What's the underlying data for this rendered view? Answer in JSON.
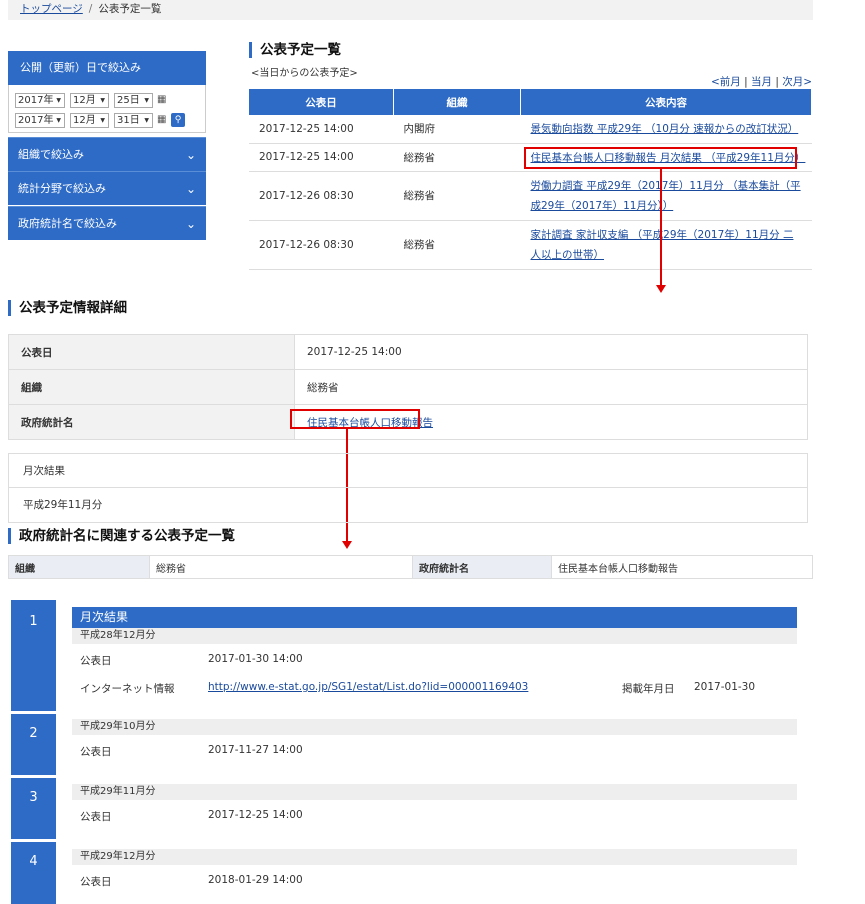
{
  "breadcrumb": {
    "home": "トップページ",
    "sep": "/",
    "current": "公表予定一覧"
  },
  "sidebar": {
    "date_filter_title": "公開（更新）日で絞込み",
    "from": {
      "year": "2017年",
      "month": "12月",
      "day": "25日"
    },
    "to": {
      "year": "2017年",
      "month": "12月",
      "day": "31日"
    },
    "items": [
      {
        "label": "組織で絞込み"
      },
      {
        "label": "統計分野で絞込み"
      },
      {
        "label": "政府統計名で絞込み"
      }
    ]
  },
  "schedule": {
    "title": "公表予定一覧",
    "subtitle": "<当日からの公表予定>",
    "nav": {
      "prev": "<前月",
      "current": "当月",
      "next": "次月>",
      "sep": "|"
    },
    "headers": {
      "date": "公表日",
      "org": "組織",
      "content": "公表内容"
    },
    "rows": [
      {
        "date": "2017-12-25 14:00",
        "org": "内閣府",
        "content": "景気動向指数 平成29年 （10月分 速報からの改訂状況）"
      },
      {
        "date": "2017-12-25 14:00",
        "org": "総務省",
        "content": "住民基本台帳人口移動報告 月次結果 （平成29年11月分）"
      },
      {
        "date": "2017-12-26 08:30",
        "org": "総務省",
        "content": "労働力調査 平成29年（2017年）11月分 （基本集計（平成29年（2017年）11月分））"
      },
      {
        "date": "2017-12-26 08:30",
        "org": "総務省",
        "content": "家計調査 家計収支編 （平成29年（2017年）11月分 二人以上の世帯）"
      }
    ]
  },
  "detail": {
    "title": "公表予定情報詳細",
    "rows": [
      {
        "label": "公表日",
        "value": "2017-12-25 14:00"
      },
      {
        "label": "組織",
        "value": "総務省"
      },
      {
        "label": "政府統計名",
        "value": "住民基本台帳人口移動報告"
      }
    ],
    "extra1": "月次結果",
    "extra2": "平成29年11月分"
  },
  "related": {
    "title": "政府統計名に関連する公表予定一覧",
    "org_label": "組織",
    "org_value": "総務省",
    "stat_label": "政府統計名",
    "stat_value": "住民基本台帳人口移動報告",
    "group_title": "月次結果",
    "date_label": "公表日",
    "internet_label": "インターネット情報",
    "posted_label": "掲載年月日",
    "items": [
      {
        "num": "1",
        "period": "平成28年12月分",
        "date": "2017-01-30 14:00",
        "url": "http://www.e-stat.go.jp/SG1/estat/List.do?lid=000001169403",
        "posted": "2017-01-30"
      },
      {
        "num": "2",
        "period": "平成29年10月分",
        "date": "2017-11-27 14:00"
      },
      {
        "num": "3",
        "period": "平成29年11月分",
        "date": "2017-12-25 14:00"
      },
      {
        "num": "4",
        "period": "平成29年12月分",
        "date": "2018-01-29 14:00"
      }
    ]
  },
  "colors": {
    "accent": "#2e6bc6",
    "highlight": "#e00000"
  }
}
